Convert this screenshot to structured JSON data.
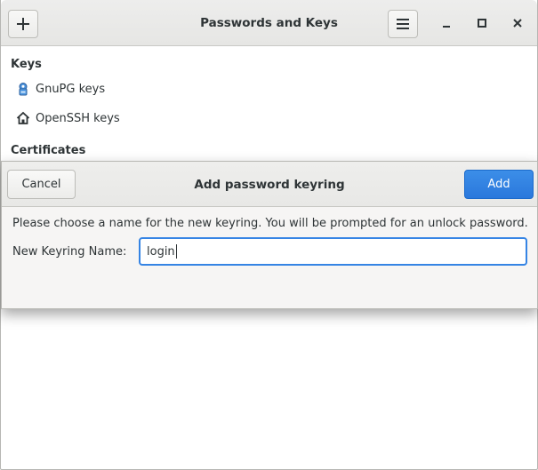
{
  "window": {
    "title": "Passwords and Keys",
    "add_icon": "plus-icon",
    "menu_icon": "hamburger-menu-icon",
    "minimize_icon": "minimize-icon",
    "maximize_icon": "maximize-icon",
    "close_icon": "close-icon"
  },
  "sidebar": {
    "keys_heading": "Keys",
    "items": [
      {
        "label": "GnuPG keys",
        "icon": "gnupg-key-icon"
      },
      {
        "label": "OpenSSH keys",
        "icon": "home-icon"
      }
    ],
    "certificates_heading": "Certificates"
  },
  "dialog": {
    "title": "Add password keyring",
    "cancel_label": "Cancel",
    "add_label": "Add",
    "message": "Please choose a name for the new keyring. You will be prompted for an unlock password.",
    "name_label": "New Keyring Name:",
    "name_value": "login"
  },
  "colors": {
    "accent": "#3584e4",
    "text": "#2e3436",
    "headerbar": "#e8e8e7"
  }
}
